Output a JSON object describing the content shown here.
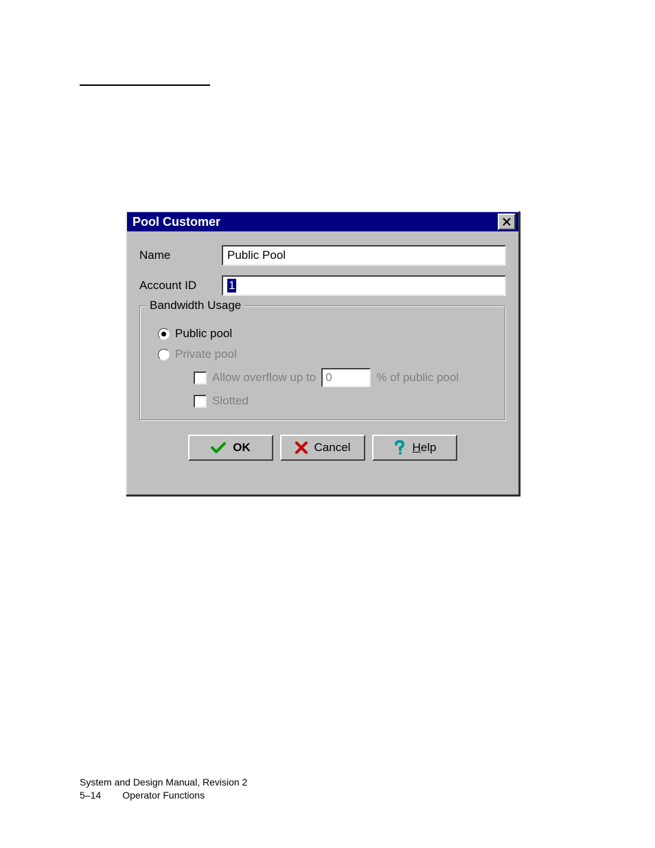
{
  "dialog": {
    "title": "Pool Customer",
    "name_label": "Name",
    "name_value": "Public Pool",
    "account_label": "Account ID",
    "account_value": "1",
    "group_legend": "Bandwidth Usage",
    "radio_public": "Public pool",
    "radio_private": "Private pool",
    "overflow_cb_label": "Allow overflow up to",
    "overflow_value": "0",
    "overflow_suffix": "% of public pool",
    "slotted_label": "Slotted",
    "buttons": {
      "ok": "OK",
      "cancel": "Cancel",
      "help": "Help"
    }
  },
  "footer": {
    "line1": "System and Design Manual, Revision 2",
    "page": "5–14",
    "section": "Operator Functions"
  },
  "colors": {
    "titlebar": "#000080",
    "face": "#c0c0c0",
    "ok_icon": "#009900",
    "cancel_icon": "#cc0000",
    "help_icon": "#009999"
  }
}
